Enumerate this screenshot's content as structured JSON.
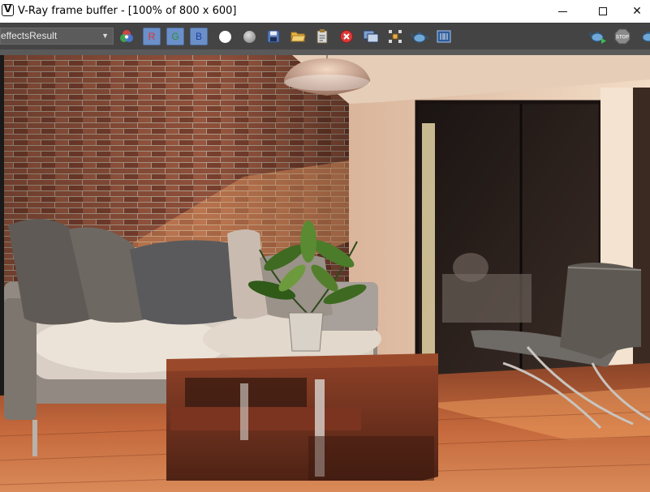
{
  "window": {
    "title": "V-Ray frame buffer - [100% of 800 x 600]",
    "logo_letter": "V",
    "minimize_icon": "minimize-icon",
    "maximize_icon": "maximize-icon",
    "close_glyph": "✕"
  },
  "toolbar": {
    "channel_value": "effectsResult",
    "channel_arrow": "▼",
    "r_label": "R",
    "g_label": "G",
    "b_label": "B",
    "icons": [
      "color-channels-icon",
      "white-dot-icon",
      "grey-dot-icon",
      "save-icon",
      "open-folder-icon",
      "clipboard-icon",
      "clear-icon",
      "duplicate-icon",
      "region-render-icon",
      "render-teapot-icon",
      "lens-effects-icon",
      "render-start-icon",
      "stop-icon",
      "render-last-icon"
    ],
    "stop_label": "STOP"
  },
  "colors": {
    "toolbar_bg": "#444444",
    "rgb_button": "#6b8fc8",
    "brick": "#8a4a34",
    "floor": "#b0603a",
    "wall": "#e9c7a9"
  }
}
